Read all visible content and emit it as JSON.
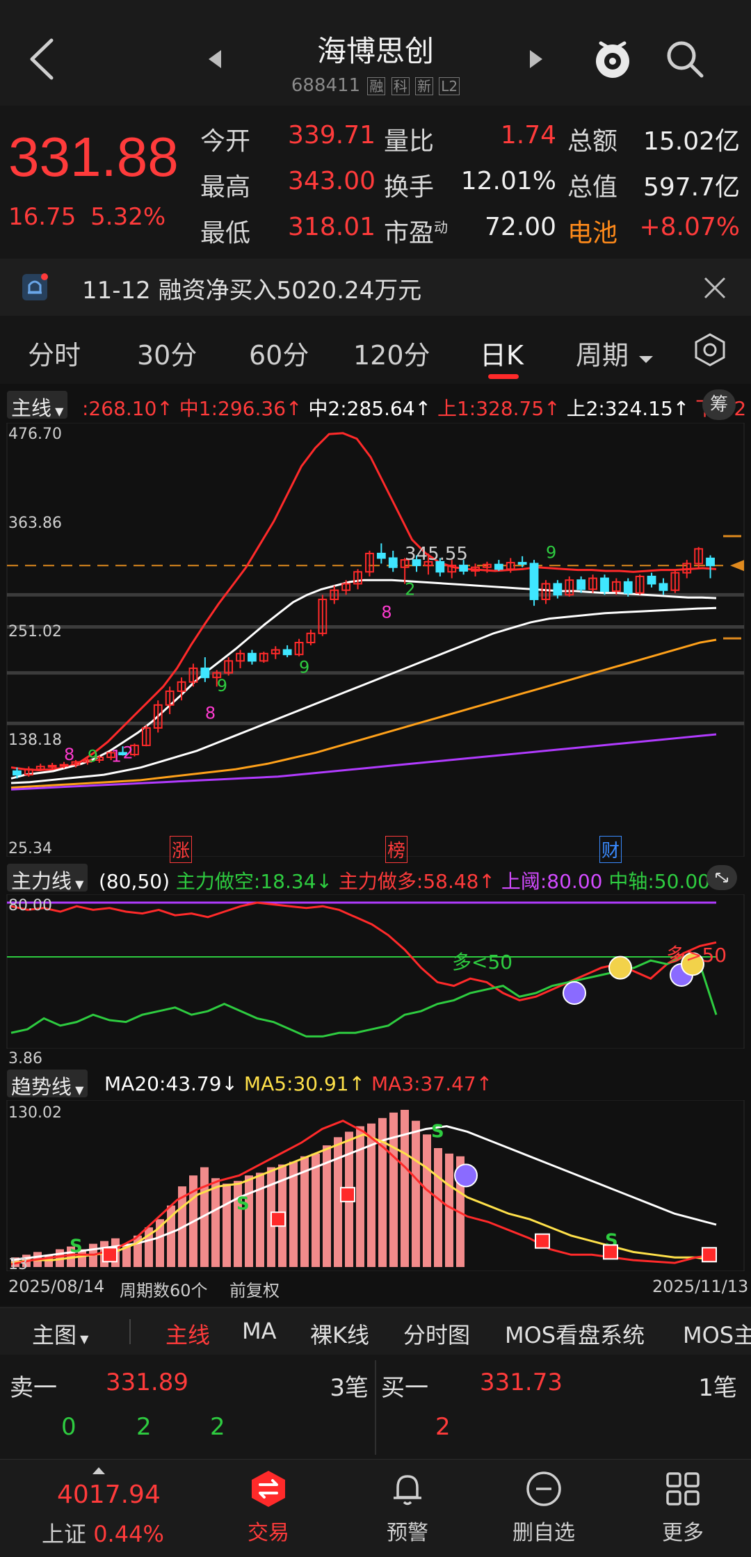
{
  "header": {
    "title": "海博思创",
    "code": "688411",
    "badges": [
      "融",
      "科",
      "新",
      "L2"
    ]
  },
  "quote": {
    "price": "331.88",
    "change": "16.75",
    "change_pct": "5.32%",
    "rows": [
      [
        {
          "label": "今开",
          "value": "339.71"
        },
        {
          "label": "量比",
          "value": "1.74"
        },
        {
          "label": "总额",
          "value": "15.02亿"
        }
      ],
      [
        {
          "label": "最高",
          "value": "343.00"
        },
        {
          "label": "换手",
          "value": "12.01%"
        },
        {
          "label": "总值",
          "value": "597.7亿"
        }
      ],
      [
        {
          "label": "最低",
          "value": "318.01"
        },
        {
          "label": "市盈",
          "value": "72.00",
          "sup": "动"
        },
        {
          "label": "电池",
          "value": "+8.07%"
        }
      ]
    ]
  },
  "notice": {
    "text": "11-12 融资净买入5020.24万元"
  },
  "tabs": {
    "items": [
      "分时",
      "30分",
      "60分",
      "120分",
      "日K",
      "周期"
    ],
    "active": "日K"
  },
  "main_panel": {
    "selector": "主线",
    "legend": [
      {
        "text": ":268.10↑",
        "color": "#ff3b3b"
      },
      {
        "text": "中1:296.36↑",
        "color": "#ff3b3b"
      },
      {
        "text": "中2:285.64↑",
        "color": "#ffffff"
      },
      {
        "text": "上1:328.75↑",
        "color": "#ff3b3b"
      },
      {
        "text": "上2:324.15↑",
        "color": "#ffffff"
      },
      {
        "text": "下1:2",
        "color": "#ff3b3b"
      }
    ],
    "extra_button": "筹",
    "y_labels": [
      "476.70",
      "363.86",
      "251.02",
      "138.18",
      "25.34"
    ],
    "price_marker": "345.55",
    "markers": [
      "涨",
      "榜",
      "财"
    ],
    "digits": [
      "8",
      "9",
      "1",
      "2",
      "8",
      "9",
      "9",
      "8",
      "2",
      "9"
    ]
  },
  "force_panel": {
    "selector": "主力线",
    "params": "(80,50)",
    "legend": [
      {
        "text": "主力做空:18.34↓",
        "color": "#2ecc40"
      },
      {
        "text": "主力做多:58.48↑",
        "color": "#ff3b3b"
      },
      {
        "text": "上阈:80.00",
        "color": "#d24bff"
      },
      {
        "text": "中轴:50.00",
        "color": "#2ecc40"
      }
    ],
    "y_labels": [
      "80.00",
      "3.86"
    ],
    "notes": [
      "多<50",
      "多>50"
    ]
  },
  "trend_panel": {
    "selector": "趋势线",
    "legend": [
      {
        "text": "MA20:43.79↓",
        "color": "#ffffff"
      },
      {
        "text": "MA5:30.91↑",
        "color": "#ffe14a"
      },
      {
        "text": "MA3:37.47↑",
        "color": "#ff3b3b"
      }
    ],
    "y_labels": [
      "130.02",
      "13"
    ],
    "date_start": "2025/08/14",
    "period_count": "周期数60个",
    "adjust": "前复权",
    "date_end": "2025/11/13"
  },
  "subtabs": {
    "main": "主图",
    "items": [
      "主线",
      "MA",
      "裸K线",
      "分时图",
      "MOS看盘系统",
      "MOS主"
    ],
    "active": "主线"
  },
  "book": {
    "sell": {
      "label": "卖一",
      "price": "331.89",
      "qty": "3笔",
      "levels": [
        "0",
        "2",
        "2"
      ]
    },
    "buy": {
      "label": "买一",
      "price": "331.73",
      "qty": "1笔",
      "levels": [
        "2"
      ]
    }
  },
  "nav": {
    "index_value": "4017.94",
    "index_name": "上证",
    "index_pct": "0.44%",
    "items": [
      "交易",
      "预警",
      "删自选",
      "更多"
    ]
  },
  "chart_data": {
    "type": "candlestick",
    "title": "",
    "ylim": [
      25.34,
      476.7
    ],
    "y_ticks": [
      476.7,
      363.86,
      251.02,
      138.18,
      25.34
    ],
    "candles": [
      [
        108,
        112,
        100,
        104
      ],
      [
        104,
        113,
        102,
        110
      ],
      [
        110,
        116,
        108,
        113
      ],
      [
        113,
        117,
        110,
        114
      ],
      [
        114,
        118,
        111,
        115
      ],
      [
        115,
        120,
        112,
        118
      ],
      [
        118,
        122,
        115,
        120
      ],
      [
        120,
        125,
        117,
        123
      ],
      [
        123,
        130,
        120,
        128
      ],
      [
        128,
        135,
        125,
        126
      ],
      [
        126,
        138,
        124,
        136
      ],
      [
        136,
        158,
        135,
        155
      ],
      [
        155,
        185,
        150,
        180
      ],
      [
        180,
        200,
        170,
        195
      ],
      [
        195,
        210,
        185,
        205
      ],
      [
        205,
        225,
        200,
        220
      ],
      [
        220,
        232,
        205,
        210
      ],
      [
        210,
        218,
        200,
        215
      ],
      [
        215,
        232,
        212,
        228
      ],
      [
        228,
        240,
        220,
        236
      ],
      [
        236,
        240,
        224,
        228
      ],
      [
        228,
        238,
        226,
        236
      ],
      [
        236,
        244,
        230,
        240
      ],
      [
        240,
        245,
        232,
        235
      ],
      [
        235,
        252,
        233,
        248
      ],
      [
        248,
        262,
        245,
        258
      ],
      [
        258,
        300,
        255,
        295
      ],
      [
        295,
        310,
        290,
        305
      ],
      [
        305,
        316,
        300,
        312
      ],
      [
        312,
        328,
        306,
        325
      ],
      [
        325,
        348,
        320,
        345
      ],
      [
        345,
        356,
        334,
        340
      ],
      [
        340,
        348,
        325,
        330
      ],
      [
        330,
        340,
        312,
        338
      ],
      [
        338,
        343,
        325,
        332
      ],
      [
        332,
        345,
        322,
        336
      ],
      [
        336,
        340,
        320,
        325
      ],
      [
        325,
        338,
        318,
        332
      ],
      [
        332,
        338,
        322,
        326
      ],
      [
        326,
        334,
        320,
        330
      ],
      [
        330,
        336,
        324,
        333
      ],
      [
        333,
        338,
        326,
        328
      ],
      [
        328,
        340,
        324,
        335
      ],
      [
        335,
        342,
        330,
        334
      ],
      [
        334,
        338,
        288,
        295
      ],
      [
        295,
        316,
        290,
        312
      ],
      [
        312,
        316,
        296,
        300
      ],
      [
        300,
        320,
        298,
        316
      ],
      [
        316,
        320,
        302,
        306
      ],
      [
        306,
        322,
        302,
        318
      ],
      [
        318,
        322,
        300,
        304
      ],
      [
        304,
        318,
        300,
        314
      ],
      [
        314,
        318,
        298,
        302
      ],
      [
        302,
        322,
        300,
        320
      ],
      [
        320,
        324,
        308,
        312
      ],
      [
        312,
        318,
        300,
        305
      ],
      [
        305,
        328,
        302,
        324
      ],
      [
        324,
        338,
        318,
        334
      ],
      [
        334,
        352,
        328,
        350
      ],
      [
        339.71,
        343,
        318.01,
        331.88
      ]
    ],
    "series": [
      {
        "name": "上1",
        "values": [
          112,
          110,
          109,
          110,
          112,
          118,
          128,
          140,
          155,
          170,
          185,
          200,
          220,
          245,
          268,
          290,
          310,
          330,
          355,
          380,
          410,
          440,
          460,
          475,
          476,
          470,
          450,
          420,
          390,
          360,
          345,
          335,
          330,
          328,
          327,
          326,
          327,
          328,
          330,
          329,
          328,
          327,
          327,
          326,
          326,
          325,
          326,
          327,
          327,
          328,
          329,
          328
        ]
      },
      {
        "name": "中1",
        "values": [
          100,
          104,
          106,
          108,
          112,
          116,
          122,
          130,
          140,
          150,
          162,
          176,
          190,
          205,
          218,
          230,
          242,
          255,
          268,
          280,
          292,
          300,
          306,
          310,
          314,
          316,
          316,
          316,
          315,
          314,
          313,
          312,
          311,
          310,
          309,
          308,
          307,
          306,
          305,
          304,
          304,
          303,
          302,
          302,
          301,
          300,
          299,
          298,
          297,
          297,
          296.36
        ]
      },
      {
        "name": "中2",
        "values": [
          95,
          96,
          98,
          100,
          102,
          104,
          108,
          112,
          118,
          124,
          130,
          138,
          146,
          154,
          162,
          170,
          178,
          186,
          194,
          202,
          210,
          218,
          226,
          234,
          242,
          250,
          258,
          264,
          270,
          274,
          276,
          278,
          280,
          281,
          282,
          283,
          284,
          285,
          285.64
        ]
      },
      {
        "name": "MA",
        "values": [
          90,
          91,
          92,
          93,
          94,
          95,
          96,
          97,
          98,
          100,
          102,
          104,
          106,
          108,
          110,
          113,
          116,
          120,
          124,
          128,
          133,
          138,
          143,
          148,
          153,
          158,
          163,
          168,
          173,
          178,
          183,
          188,
          193,
          198,
          203,
          208,
          213,
          218,
          223,
          228,
          233,
          238,
          243,
          248,
          251
        ]
      },
      {
        "name": "MA long",
        "values": [
          88,
          89,
          90,
          91,
          92,
          93,
          94,
          95,
          96,
          97,
          98,
          99,
          100,
          101,
          102,
          104,
          106,
          108,
          110,
          112,
          114,
          116,
          118,
          120,
          122,
          124,
          126,
          128,
          130,
          132,
          134,
          136,
          138,
          140,
          142,
          144,
          146,
          148
        ]
      }
    ]
  }
}
